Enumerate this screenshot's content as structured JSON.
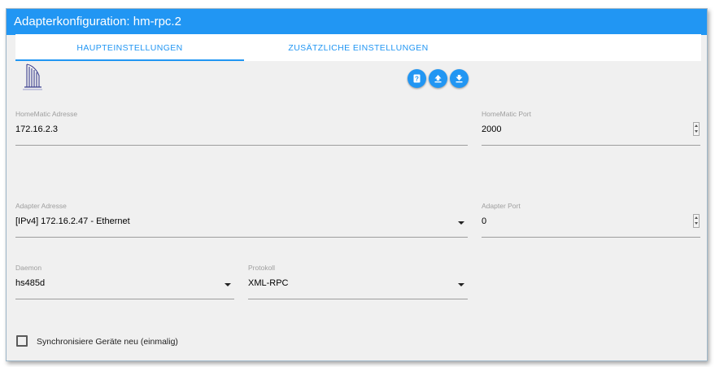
{
  "window": {
    "title": "Adapterkonfiguration: hm-rpc.2"
  },
  "tabs": [
    {
      "label": "HAUPTEINSTELLUNGEN",
      "active": true
    },
    {
      "label": "ZUSÄTZLICHE EINSTELLUNGEN",
      "active": false
    }
  ],
  "toolbar": {
    "buttons": [
      {
        "icon": "help-icon"
      },
      {
        "icon": "upload-icon"
      },
      {
        "icon": "download-icon"
      }
    ]
  },
  "fields": {
    "homematic_address": {
      "label": "HomeMatic Adresse",
      "value": "172.16.2.3"
    },
    "homematic_port": {
      "label": "HomeMatic Port",
      "value": "2000"
    },
    "adapter_address": {
      "label": "Adapter Adresse",
      "value": "[IPv4] 172.16.2.47 - Ethernet"
    },
    "adapter_port": {
      "label": "Adapter Port",
      "value": "0"
    },
    "daemon": {
      "label": "Daemon",
      "value": "hs485d"
    },
    "protocol": {
      "label": "Protokoll",
      "value": "XML-RPC"
    }
  },
  "sync_checkbox": {
    "label": "Synchronisiere Geräte neu (einmalig)",
    "checked": false
  },
  "colors": {
    "accent": "#2196f3",
    "panel": "#f0f0f0",
    "underline": "#9e9e9e"
  }
}
